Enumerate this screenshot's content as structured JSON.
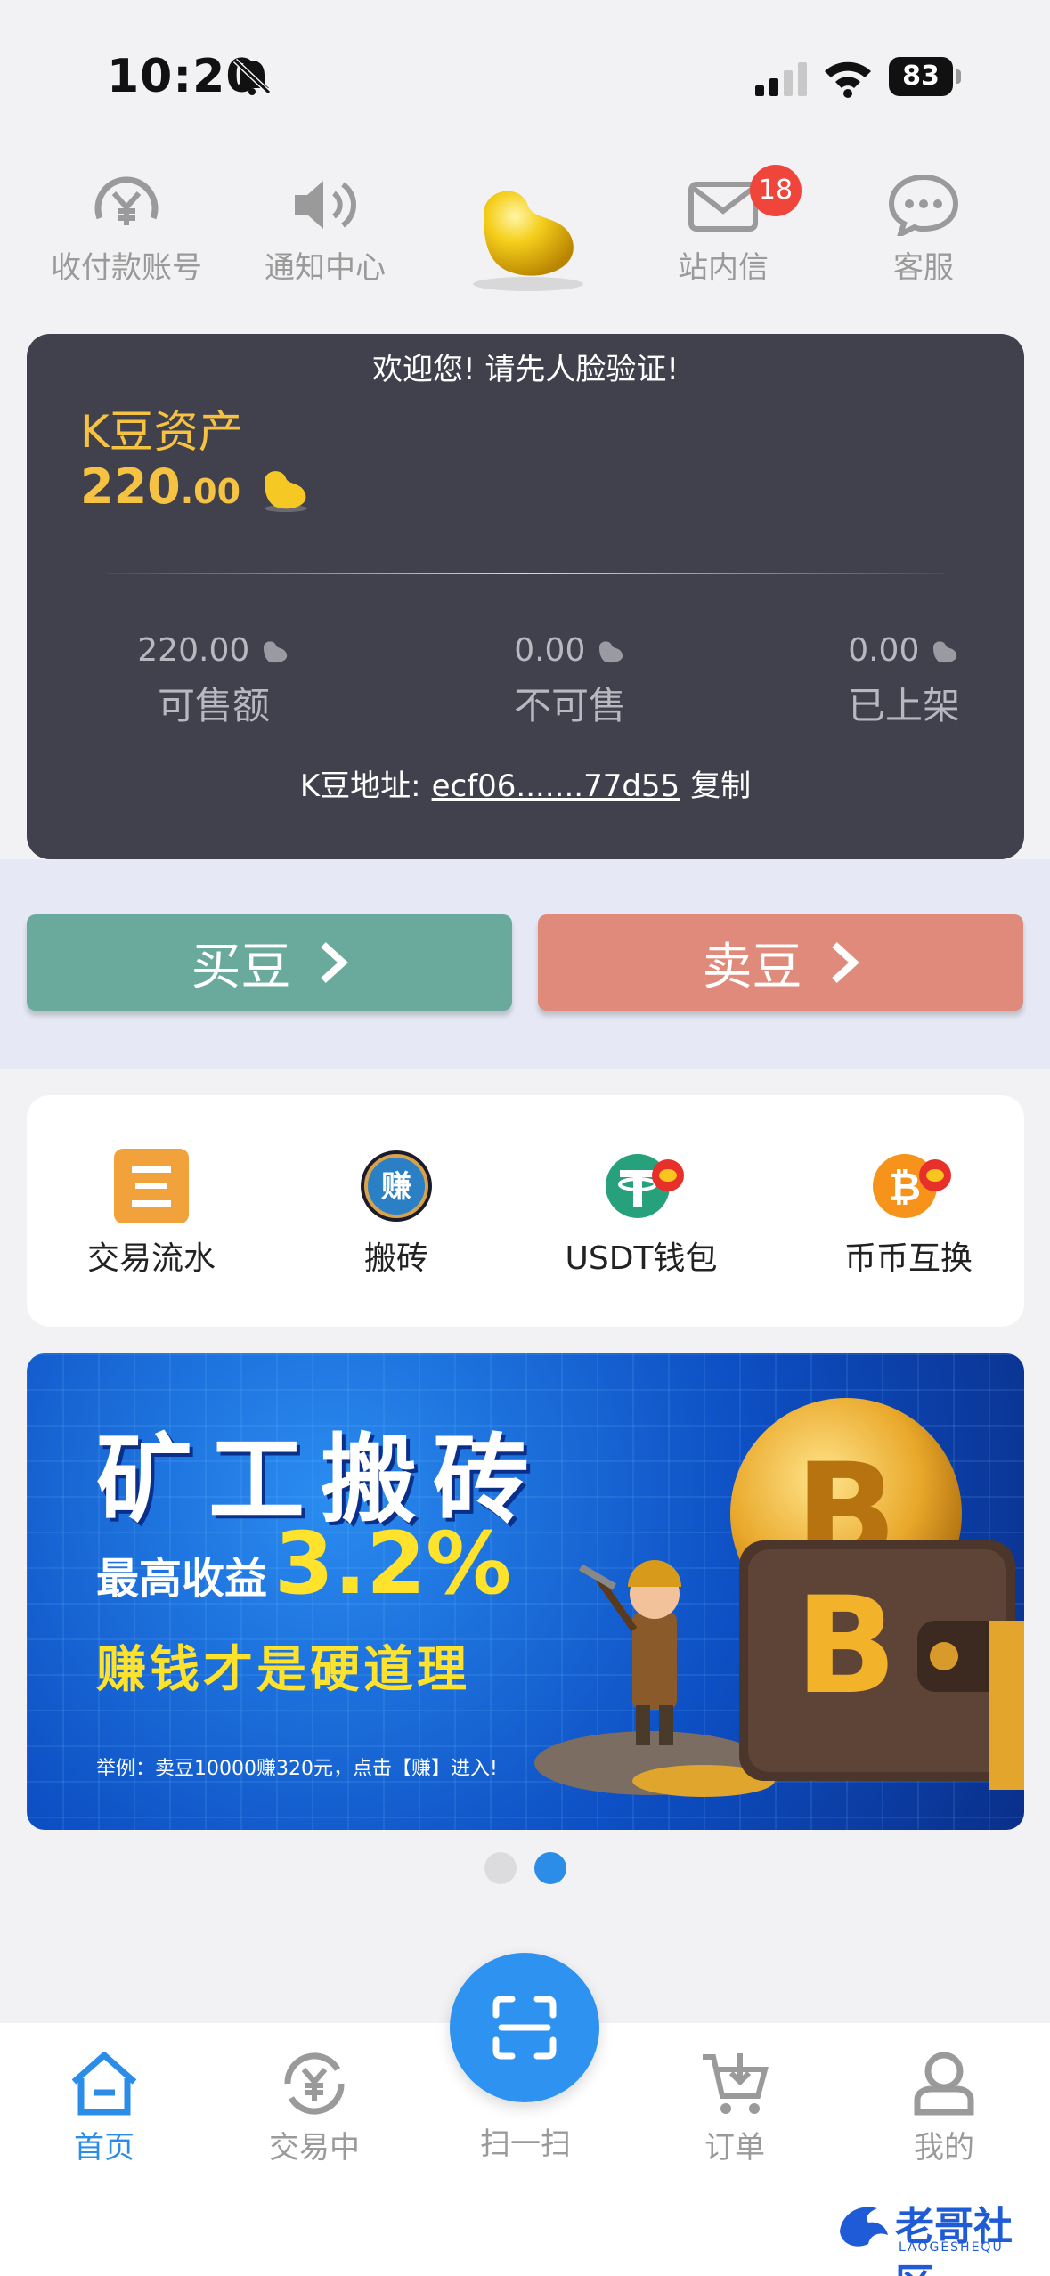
{
  "status_bar": {
    "time": "10:20",
    "battery": "83"
  },
  "top_nav": {
    "items": [
      {
        "label": "收付款账号",
        "icon": "yuan-circle-icon"
      },
      {
        "label": "通知中心",
        "icon": "speaker-icon"
      },
      {
        "label": "",
        "icon": "gold-bean-icon"
      },
      {
        "label": "站内信",
        "icon": "mail-icon",
        "badge": "18"
      },
      {
        "label": "客服",
        "icon": "chat-bubble-icon"
      }
    ]
  },
  "asset_card": {
    "welcome": "欢迎您! 请先人脸验证!",
    "title": "K豆资产",
    "amount_int": "220",
    "amount_dec": ".00",
    "stats": [
      {
        "value": "220.00",
        "label": "可售额"
      },
      {
        "value": "0.00",
        "label": "不可售"
      },
      {
        "value": "0.00",
        "label": "已上架"
      }
    ],
    "address_label": "K豆地址:",
    "address_value": "ecf06.......77d55",
    "copy_label": "复制"
  },
  "trade": {
    "buy_label": "买豆",
    "sell_label": "卖豆",
    "buy_color": "#6aaa9c",
    "sell_color": "#df8a7a"
  },
  "quick_actions": [
    {
      "label": "交易流水",
      "icon": "ledger-icon"
    },
    {
      "label": "搬砖",
      "icon": "earn-coin-icon",
      "icon_text": "赚"
    },
    {
      "label": "USDT钱包",
      "icon": "tether-icon"
    },
    {
      "label": "币币互换",
      "icon": "bitcoin-swap-icon"
    }
  ],
  "banner": {
    "title": "矿工搬砖",
    "subtitle_prefix": "最高收益",
    "subtitle_pct": "3.2%",
    "slogan": "赚钱才是硬道理",
    "footnote": "举例：卖豆10000赚320元，点击【赚】进入!"
  },
  "carousel": {
    "total": 2,
    "active_index": 1
  },
  "tab_bar": {
    "items": [
      {
        "label": "首页",
        "icon": "home-icon",
        "active": true
      },
      {
        "label": "交易中",
        "icon": "yuan-cycle-icon",
        "active": false
      },
      {
        "label": "扫一扫",
        "icon": "scan-icon",
        "active": false
      },
      {
        "label": "订单",
        "icon": "cart-icon",
        "active": false
      },
      {
        "label": "我的",
        "icon": "user-icon",
        "active": false
      }
    ],
    "active_color": "#2b8de8"
  },
  "watermark": {
    "title": "老哥社区",
    "subtitle": "LAOGESHEQU"
  }
}
